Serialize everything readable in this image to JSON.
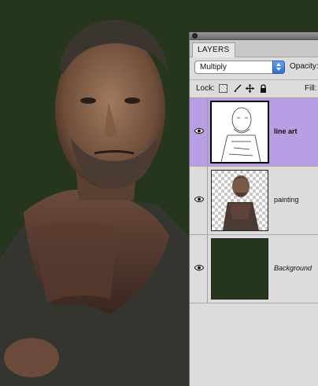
{
  "panel": {
    "tab_label": "LAYERS",
    "blend_mode": "Multiply",
    "opacity_label": "Opacity:",
    "lock_label": "Lock:",
    "fill_label": "Fill:"
  },
  "layers": [
    {
      "name": "line art",
      "selected": true,
      "visible": true
    },
    {
      "name": "painting",
      "selected": false,
      "visible": true
    },
    {
      "name": "Background",
      "selected": false,
      "visible": true
    }
  ],
  "colors": {
    "canvas_background": "#25361d",
    "selected_layer": "#b89ee2",
    "panel": "#dcdcdc"
  },
  "icons": [
    "close-icon",
    "dropdown-arrow-icon",
    "lock-transparent-icon",
    "lock-brush-icon",
    "lock-move-icon",
    "lock-all-icon",
    "eye-icon"
  ]
}
